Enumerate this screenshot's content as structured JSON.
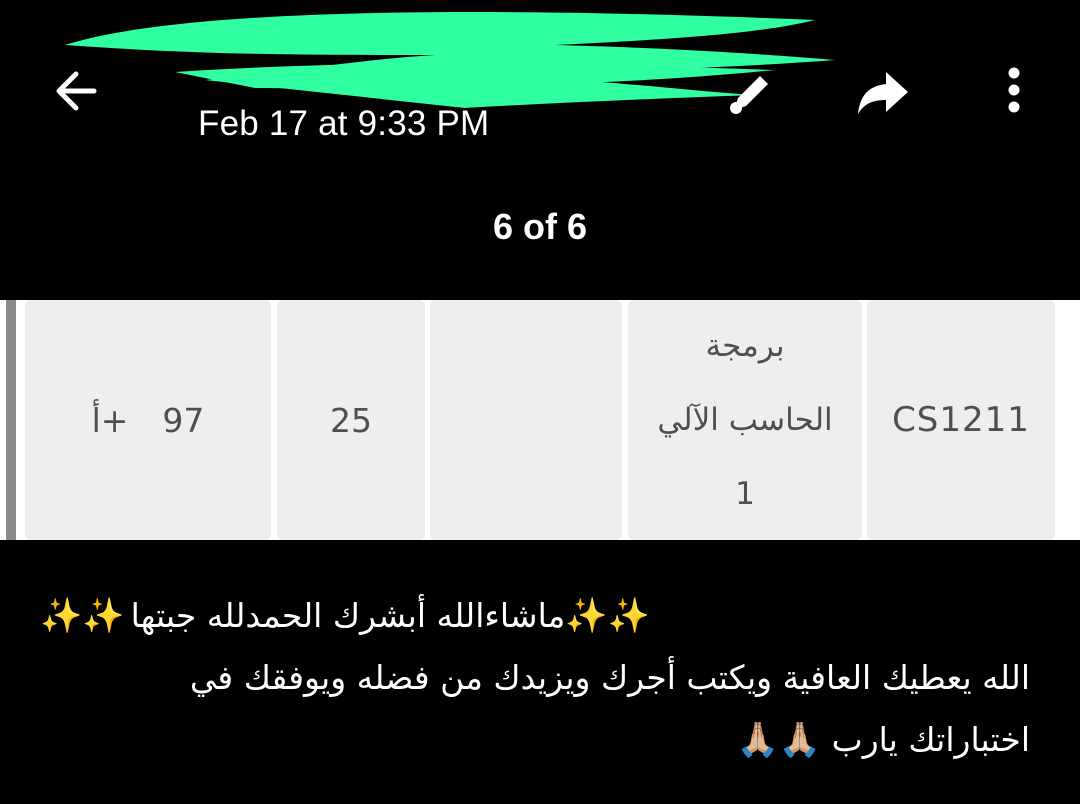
{
  "header": {
    "date": "Feb 17 at 9:33 PM",
    "counter": "6 of 6",
    "back_icon": "arrow-left-icon",
    "edit_icon": "pencil-icon",
    "share_icon": "forward-arrow-icon",
    "more_icon": "vertical-dots-icon",
    "redaction_color": "#2fffa0"
  },
  "grade_row": {
    "course_code": "CS1211",
    "course_name_line1": "برمجة",
    "course_name_line2": "الحاسب الآلي",
    "course_name_line3": "1",
    "credit_blank": "",
    "hours": "25",
    "mark": "97",
    "grade": "أ+"
  },
  "caption": {
    "line1_text": "ماشاءالله أبشرك الحمدلله جبتها",
    "line1_sparkles_right": "✨✨",
    "line1_sparkles_left": "✨✨",
    "line2_text": "الله يعطيك العافية ويكتب أجرك ويزيدك من فضله ويوفقك في",
    "line3_text": "اختباراتك يارب",
    "line3_hands": "🙏🏼🙏🏼"
  }
}
